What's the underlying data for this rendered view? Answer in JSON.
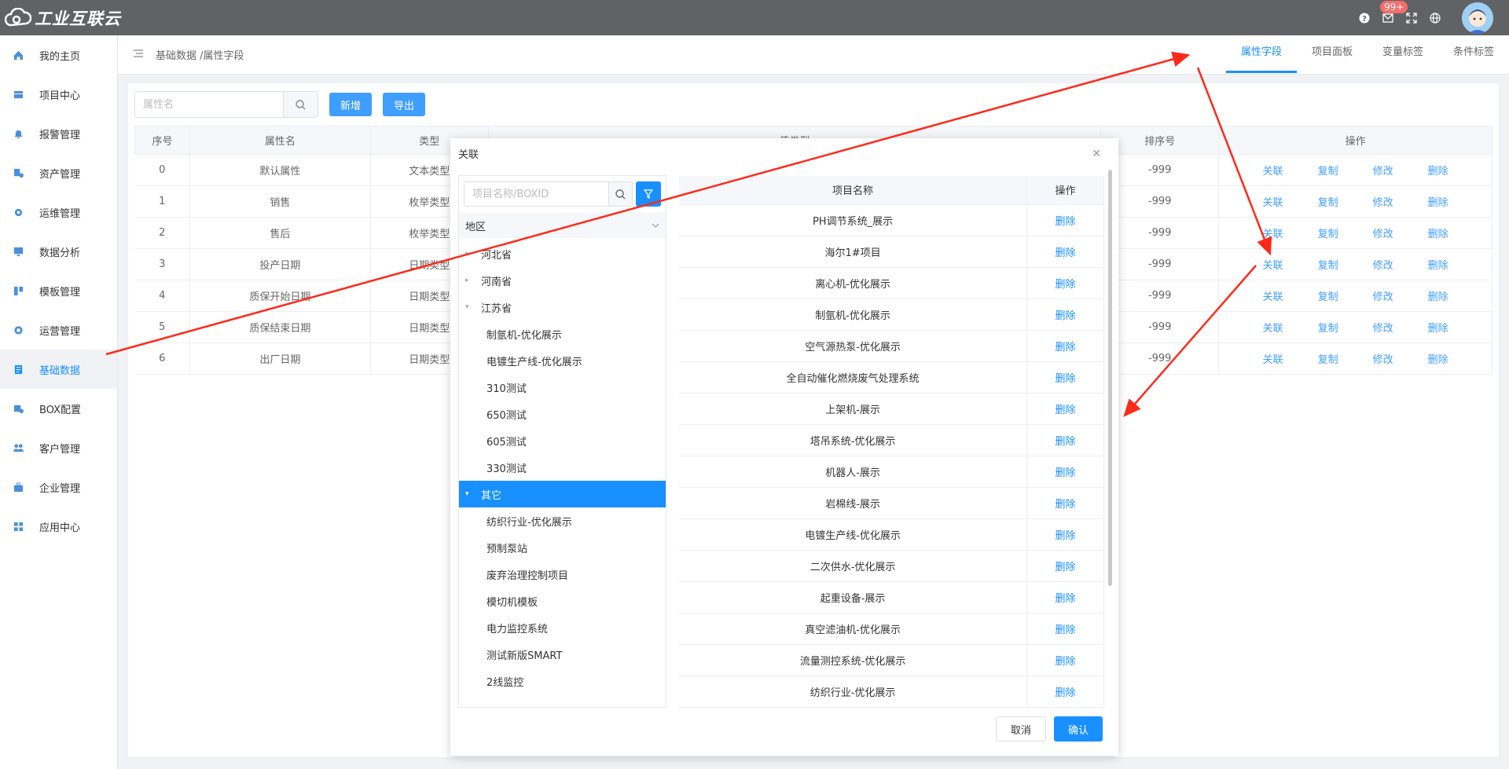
{
  "app": {
    "logo_text": "工业互联云",
    "notification_badge": "99+"
  },
  "sidebar": {
    "items": [
      {
        "label": "我的主页",
        "icon": "home-icon"
      },
      {
        "label": "项目中心",
        "icon": "project-icon"
      },
      {
        "label": "报警管理",
        "icon": "bell-icon"
      },
      {
        "label": "资产管理",
        "icon": "asset-icon"
      },
      {
        "label": "运维管理",
        "icon": "gear-icon"
      },
      {
        "label": "数据分析",
        "icon": "monitor-icon"
      },
      {
        "label": "模板管理",
        "icon": "template-icon"
      },
      {
        "label": "运营管理",
        "icon": "operation-icon"
      },
      {
        "label": "基础数据",
        "icon": "document-icon",
        "active": true
      },
      {
        "label": "BOX配置",
        "icon": "box-config-icon"
      },
      {
        "label": "客户管理",
        "icon": "users-icon"
      },
      {
        "label": "企业管理",
        "icon": "briefcase-icon"
      },
      {
        "label": "应用中心",
        "icon": "apps-icon"
      }
    ]
  },
  "header": {
    "breadcrumb": "基础数据 /属性字段",
    "tabs": [
      "属性字段",
      "项目面板",
      "变量标签",
      "条件标签"
    ],
    "active_tab": 0
  },
  "toolbar": {
    "search_placeholder": "属性名",
    "add_label": "新增",
    "export_label": "导出"
  },
  "main_table": {
    "columns": [
      "序号",
      "属性名",
      "类型",
      "值类型",
      "排序号",
      "操作"
    ],
    "rows": [
      {
        "index": "0",
        "name": "默认属性",
        "type": "文本类型",
        "sort": "-999"
      },
      {
        "index": "1",
        "name": "销售",
        "type": "枚举类型",
        "sort": "-999"
      },
      {
        "index": "2",
        "name": "售后",
        "type": "枚举类型",
        "sort": "-999"
      },
      {
        "index": "3",
        "name": "投产日期",
        "type": "日期类型",
        "sort": "-999"
      },
      {
        "index": "4",
        "name": "质保开始日期",
        "type": "日期类型",
        "sort": "-999"
      },
      {
        "index": "5",
        "name": "质保结束日期",
        "type": "日期类型",
        "sort": "-999"
      },
      {
        "index": "6",
        "name": "出厂日期",
        "type": "日期类型",
        "sort": "-999"
      }
    ],
    "ops": [
      "关联",
      "复制",
      "修改",
      "删除"
    ]
  },
  "modal": {
    "title": "关联",
    "search_placeholder": "项目名称/BOXID",
    "region_label": "地区",
    "tree": [
      {
        "label": "河北省",
        "level": 1,
        "caret": "▸"
      },
      {
        "label": "河南省",
        "level": 1,
        "caret": "▸"
      },
      {
        "label": "江苏省",
        "level": 1,
        "caret": "▾"
      },
      {
        "label": "制氩机-优化展示",
        "level": 2
      },
      {
        "label": "电镀生产线-优化展示",
        "level": 2
      },
      {
        "label": "310测试",
        "level": 2
      },
      {
        "label": "650测试",
        "level": 2
      },
      {
        "label": "605测试",
        "level": 2
      },
      {
        "label": "330测试",
        "level": 2
      },
      {
        "label": "其它",
        "level": 1,
        "caret": "▾",
        "active": true
      },
      {
        "label": "纺织行业-优化展示",
        "level": 2
      },
      {
        "label": "预制泵站",
        "level": 2
      },
      {
        "label": "废弃治理控制项目",
        "level": 2
      },
      {
        "label": "模切机模板",
        "level": 2
      },
      {
        "label": "电力监控系统",
        "level": 2
      },
      {
        "label": "测试新版SMART",
        "level": 2
      },
      {
        "label": "2线监控",
        "level": 2
      }
    ],
    "right_columns": [
      "项目名称",
      "操作"
    ],
    "projects": [
      "PH调节系统_展示",
      "海尔1#项目",
      "离心机-优化展示",
      "制氩机-优化展示",
      "空气源热泵-优化展示",
      "全自动催化燃烧废气处理系统",
      "上架机-展示",
      "塔吊系统-优化展示",
      "机器人-展示",
      "岩棉线-展示",
      "电镀生产线-优化展示",
      "二次供水-优化展示",
      "起重设备-展示",
      "真空滤油机-优化展示",
      "流量测控系统-优化展示",
      "纺织行业-优化展示"
    ],
    "delete_label": "删除",
    "cancel_label": "取消",
    "confirm_label": "确认"
  },
  "colors": {
    "primary": "#1890ff",
    "topbar": "#606266",
    "annotation": "#ff2a1a"
  }
}
